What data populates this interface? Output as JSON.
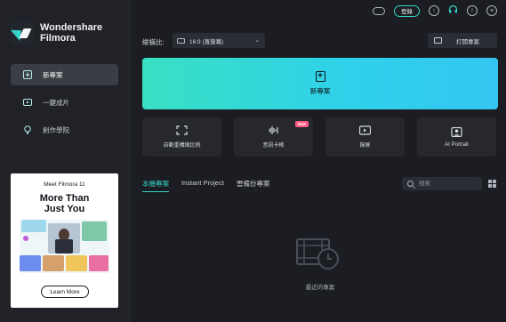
{
  "brand": {
    "line1": "Wondershare",
    "line2": "Filmora",
    "logo_icon": "filmora-logo-icon"
  },
  "sidebar": {
    "items": [
      {
        "label": "新專案",
        "icon": "plus-square-icon",
        "active": true
      },
      {
        "label": "一鍵成片",
        "icon": "auto-video-icon",
        "active": false
      },
      {
        "label": "創作學院",
        "icon": "lightbulb-icon",
        "active": false
      }
    ]
  },
  "ad": {
    "subtitle": "Meet Filmora 11",
    "title_line1": "More Than",
    "title_line2": "Just You",
    "button": "Learn More"
  },
  "topbar": {
    "login": "登錄"
  },
  "aspect": {
    "label": "縱橫比:",
    "value": "16:9 (寬螢幕)"
  },
  "open_project": {
    "label": "打開專案"
  },
  "new_project": {
    "label": "新專案"
  },
  "tools": [
    {
      "label": "自動重構縮比例",
      "icon": "auto-reframe-icon",
      "badge": ""
    },
    {
      "label": "音訊卡帳",
      "icon": "audio-wave-icon",
      "badge": "New"
    },
    {
      "label": "錄屏",
      "icon": "screen-record-icon",
      "badge": ""
    },
    {
      "label": "AI Portrait",
      "icon": "ai-portrait-icon",
      "badge": ""
    }
  ],
  "tabs": [
    {
      "label": "本機專案",
      "active": true
    },
    {
      "label": "Instant Project",
      "active": false
    },
    {
      "label": "雲備份專案",
      "active": false
    }
  ],
  "search": {
    "placeholder": "搜索",
    "value": ""
  },
  "empty": {
    "label": "最近的專案"
  },
  "colors": {
    "accent": "#36d3c7",
    "banner_start": "#39e0c2",
    "banner_end": "#34c6f2",
    "badge": "#ff5b85"
  }
}
